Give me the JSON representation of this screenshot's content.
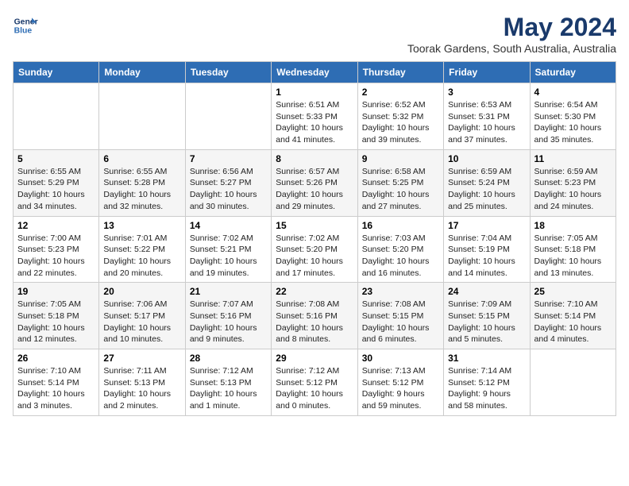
{
  "header": {
    "logo_line1": "General",
    "logo_line2": "Blue",
    "main_title": "May 2024",
    "subtitle": "Toorak Gardens, South Australia, Australia"
  },
  "days_of_week": [
    "Sunday",
    "Monday",
    "Tuesday",
    "Wednesday",
    "Thursday",
    "Friday",
    "Saturday"
  ],
  "weeks": [
    [
      {
        "day": "",
        "info": ""
      },
      {
        "day": "",
        "info": ""
      },
      {
        "day": "",
        "info": ""
      },
      {
        "day": "1",
        "info": "Sunrise: 6:51 AM\nSunset: 5:33 PM\nDaylight: 10 hours\nand 41 minutes."
      },
      {
        "day": "2",
        "info": "Sunrise: 6:52 AM\nSunset: 5:32 PM\nDaylight: 10 hours\nand 39 minutes."
      },
      {
        "day": "3",
        "info": "Sunrise: 6:53 AM\nSunset: 5:31 PM\nDaylight: 10 hours\nand 37 minutes."
      },
      {
        "day": "4",
        "info": "Sunrise: 6:54 AM\nSunset: 5:30 PM\nDaylight: 10 hours\nand 35 minutes."
      }
    ],
    [
      {
        "day": "5",
        "info": "Sunrise: 6:55 AM\nSunset: 5:29 PM\nDaylight: 10 hours\nand 34 minutes."
      },
      {
        "day": "6",
        "info": "Sunrise: 6:55 AM\nSunset: 5:28 PM\nDaylight: 10 hours\nand 32 minutes."
      },
      {
        "day": "7",
        "info": "Sunrise: 6:56 AM\nSunset: 5:27 PM\nDaylight: 10 hours\nand 30 minutes."
      },
      {
        "day": "8",
        "info": "Sunrise: 6:57 AM\nSunset: 5:26 PM\nDaylight: 10 hours\nand 29 minutes."
      },
      {
        "day": "9",
        "info": "Sunrise: 6:58 AM\nSunset: 5:25 PM\nDaylight: 10 hours\nand 27 minutes."
      },
      {
        "day": "10",
        "info": "Sunrise: 6:59 AM\nSunset: 5:24 PM\nDaylight: 10 hours\nand 25 minutes."
      },
      {
        "day": "11",
        "info": "Sunrise: 6:59 AM\nSunset: 5:23 PM\nDaylight: 10 hours\nand 24 minutes."
      }
    ],
    [
      {
        "day": "12",
        "info": "Sunrise: 7:00 AM\nSunset: 5:23 PM\nDaylight: 10 hours\nand 22 minutes."
      },
      {
        "day": "13",
        "info": "Sunrise: 7:01 AM\nSunset: 5:22 PM\nDaylight: 10 hours\nand 20 minutes."
      },
      {
        "day": "14",
        "info": "Sunrise: 7:02 AM\nSunset: 5:21 PM\nDaylight: 10 hours\nand 19 minutes."
      },
      {
        "day": "15",
        "info": "Sunrise: 7:02 AM\nSunset: 5:20 PM\nDaylight: 10 hours\nand 17 minutes."
      },
      {
        "day": "16",
        "info": "Sunrise: 7:03 AM\nSunset: 5:20 PM\nDaylight: 10 hours\nand 16 minutes."
      },
      {
        "day": "17",
        "info": "Sunrise: 7:04 AM\nSunset: 5:19 PM\nDaylight: 10 hours\nand 14 minutes."
      },
      {
        "day": "18",
        "info": "Sunrise: 7:05 AM\nSunset: 5:18 PM\nDaylight: 10 hours\nand 13 minutes."
      }
    ],
    [
      {
        "day": "19",
        "info": "Sunrise: 7:05 AM\nSunset: 5:18 PM\nDaylight: 10 hours\nand 12 minutes."
      },
      {
        "day": "20",
        "info": "Sunrise: 7:06 AM\nSunset: 5:17 PM\nDaylight: 10 hours\nand 10 minutes."
      },
      {
        "day": "21",
        "info": "Sunrise: 7:07 AM\nSunset: 5:16 PM\nDaylight: 10 hours\nand 9 minutes."
      },
      {
        "day": "22",
        "info": "Sunrise: 7:08 AM\nSunset: 5:16 PM\nDaylight: 10 hours\nand 8 minutes."
      },
      {
        "day": "23",
        "info": "Sunrise: 7:08 AM\nSunset: 5:15 PM\nDaylight: 10 hours\nand 6 minutes."
      },
      {
        "day": "24",
        "info": "Sunrise: 7:09 AM\nSunset: 5:15 PM\nDaylight: 10 hours\nand 5 minutes."
      },
      {
        "day": "25",
        "info": "Sunrise: 7:10 AM\nSunset: 5:14 PM\nDaylight: 10 hours\nand 4 minutes."
      }
    ],
    [
      {
        "day": "26",
        "info": "Sunrise: 7:10 AM\nSunset: 5:14 PM\nDaylight: 10 hours\nand 3 minutes."
      },
      {
        "day": "27",
        "info": "Sunrise: 7:11 AM\nSunset: 5:13 PM\nDaylight: 10 hours\nand 2 minutes."
      },
      {
        "day": "28",
        "info": "Sunrise: 7:12 AM\nSunset: 5:13 PM\nDaylight: 10 hours\nand 1 minute."
      },
      {
        "day": "29",
        "info": "Sunrise: 7:12 AM\nSunset: 5:12 PM\nDaylight: 10 hours\nand 0 minutes."
      },
      {
        "day": "30",
        "info": "Sunrise: 7:13 AM\nSunset: 5:12 PM\nDaylight: 9 hours\nand 59 minutes."
      },
      {
        "day": "31",
        "info": "Sunrise: 7:14 AM\nSunset: 5:12 PM\nDaylight: 9 hours\nand 58 minutes."
      },
      {
        "day": "",
        "info": ""
      }
    ]
  ]
}
